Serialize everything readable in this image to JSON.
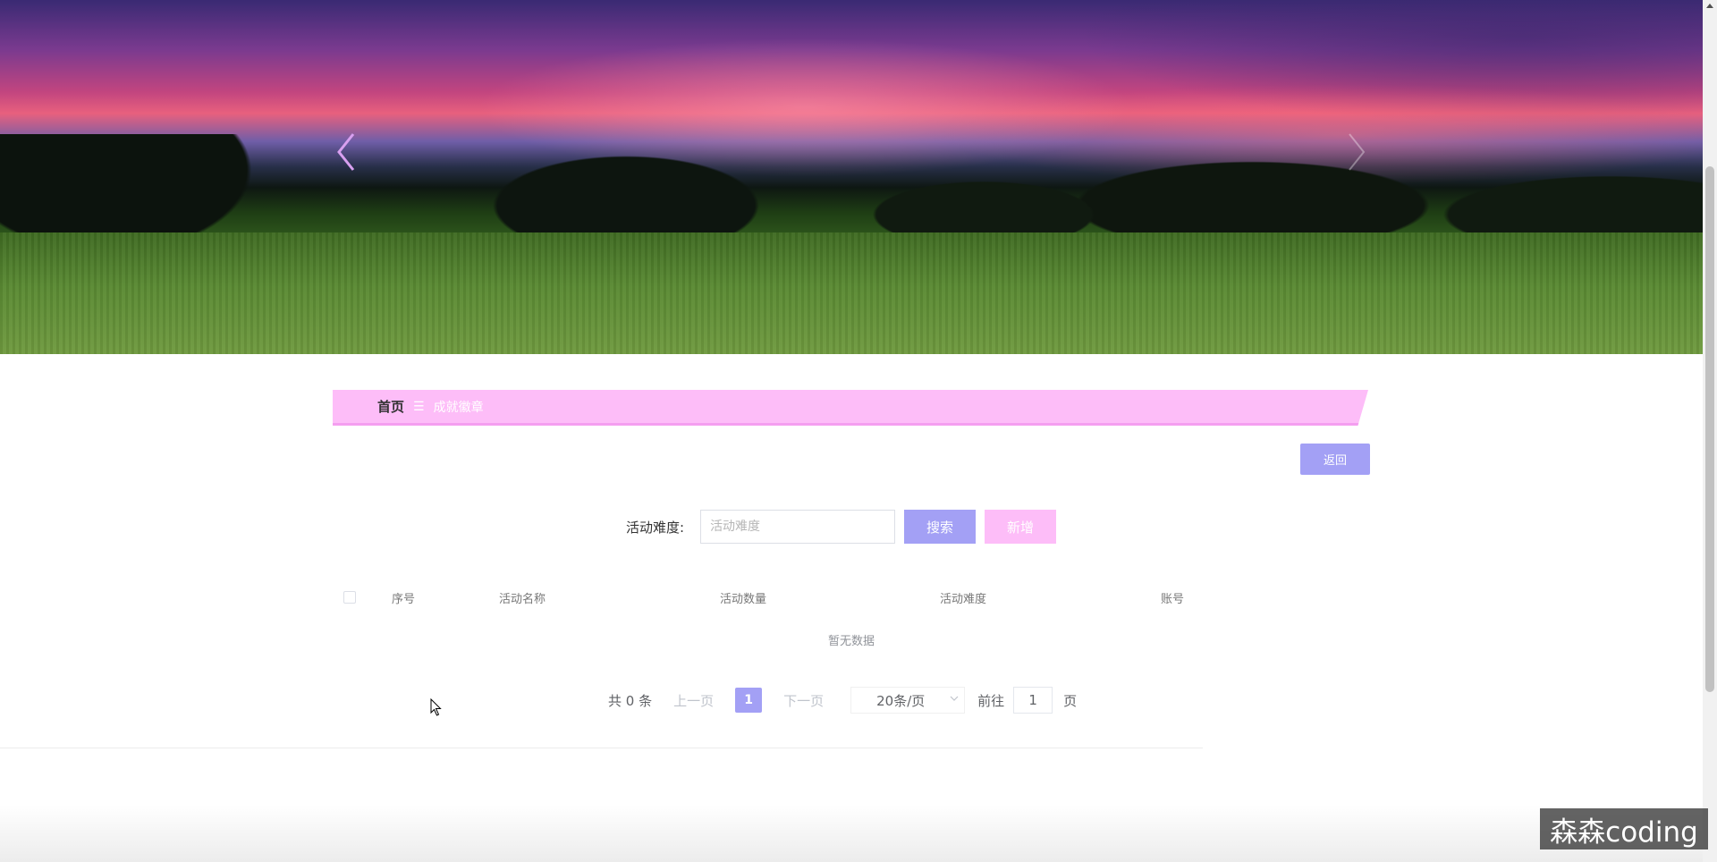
{
  "breadcrumb": {
    "home": "首页",
    "separator": "☰",
    "current": "成就徽章"
  },
  "actions": {
    "back_label": "返回"
  },
  "search": {
    "label": "活动难度:",
    "placeholder": "活动难度",
    "search_button": "搜索",
    "add_button": "新增"
  },
  "table": {
    "columns": [
      "序号",
      "活动名称",
      "活动数量",
      "活动难度",
      "账号"
    ],
    "rows": [],
    "empty_text": "暂无数据"
  },
  "pagination": {
    "total_text": "共 0 条",
    "prev": "上一页",
    "current_page": "1",
    "next": "下一页",
    "page_size": "20条/页",
    "goto_label": "前往",
    "goto_value": "1",
    "goto_suffix": "页"
  },
  "watermark": "森森coding",
  "colors": {
    "primary": "#a3a0f5",
    "secondary": "#fdbdf8"
  },
  "icons": {
    "carousel_prev": "chevron-left-icon",
    "carousel_next": "chevron-right-icon",
    "select_arrow": "chevron-down-icon",
    "cursor": "mouse-pointer-icon"
  }
}
